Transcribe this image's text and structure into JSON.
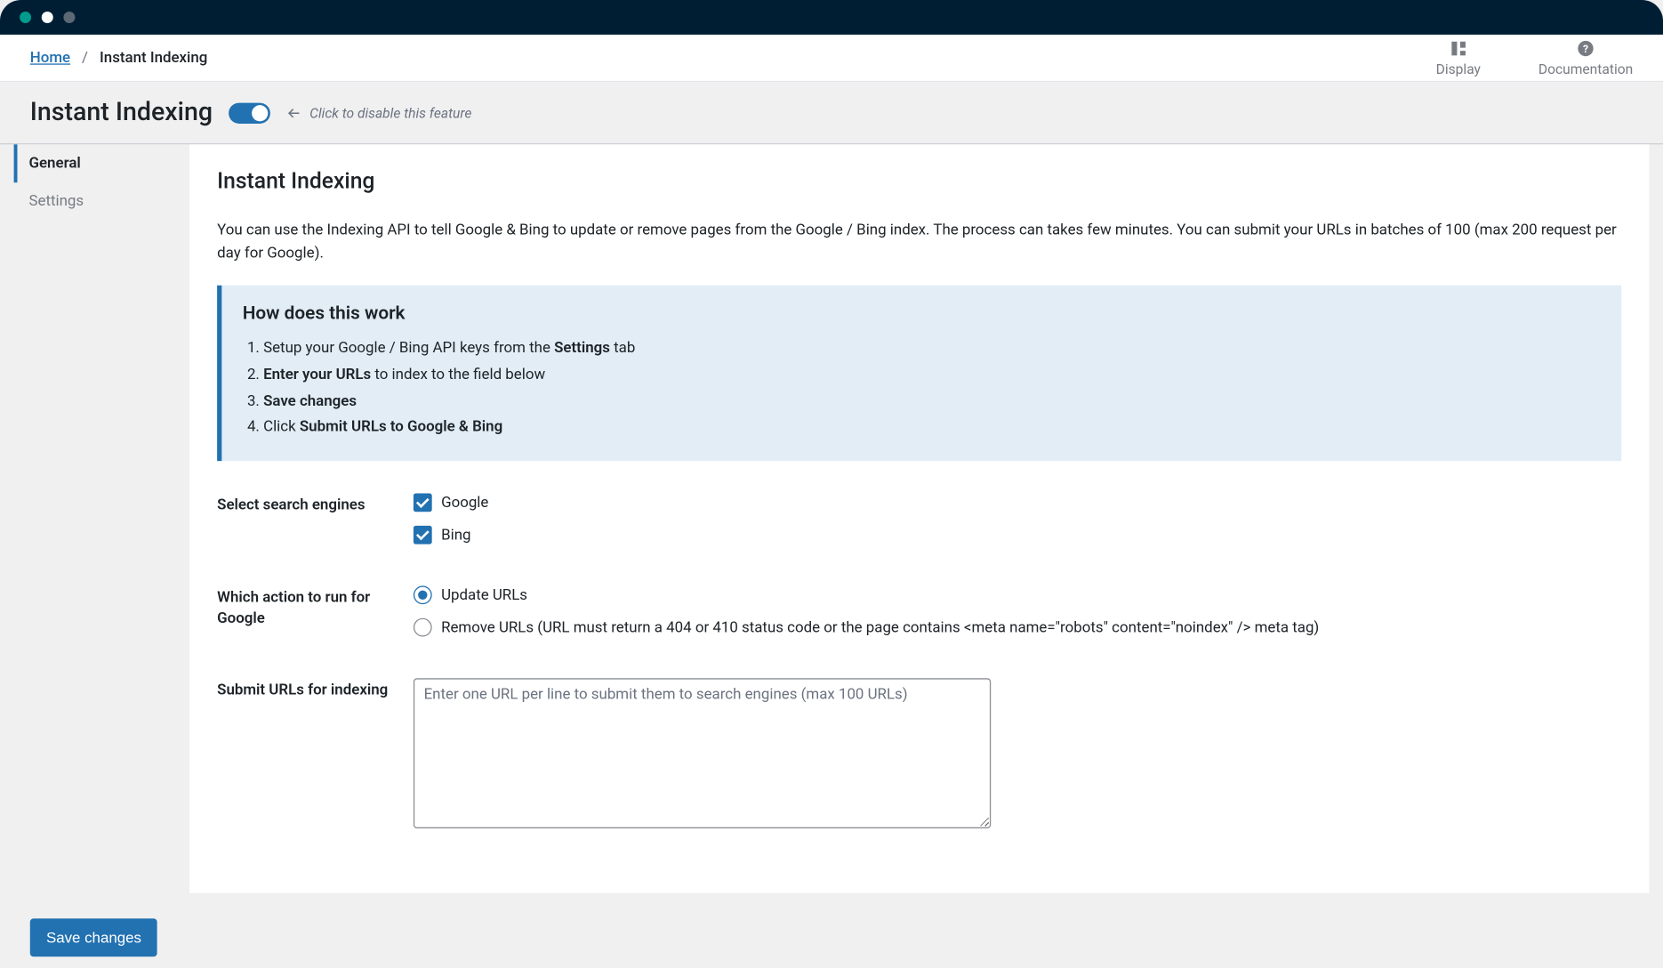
{
  "breadcrumb": {
    "home": "Home",
    "sep": "/",
    "current": "Instant Indexing"
  },
  "toplinks": {
    "display": "Display",
    "documentation": "Documentation"
  },
  "header": {
    "title": "Instant Indexing",
    "toggle_hint": "Click to disable this feature"
  },
  "tabs": [
    {
      "label": "General",
      "active": true
    },
    {
      "label": "Settings",
      "active": false
    }
  ],
  "panel": {
    "heading": "Instant Indexing",
    "description": "You can use the Indexing API to tell Google & Bing to update or remove pages from the Google / Bing index. The process can takes few minutes. You can submit your URLs in batches of 100 (max 200 request per day for Google).",
    "info": {
      "heading": "How does this work",
      "step1_pre": "Setup your Google / Bing API keys from the ",
      "step1_bold": "Settings",
      "step1_post": " tab",
      "step2_bold": "Enter your URLs",
      "step2_post": " to index to the field below",
      "step3_bold": "Save changes",
      "step4_pre": "Click ",
      "step4_bold": "Submit URLs to Google & Bing"
    },
    "engines": {
      "label": "Select search engines",
      "items": [
        {
          "name": "Google",
          "checked": true
        },
        {
          "name": "Bing",
          "checked": true
        }
      ]
    },
    "action": {
      "label": "Which action to run for Google",
      "items": [
        {
          "name": "Update URLs",
          "selected": true
        },
        {
          "name": "Remove URLs (URL must return a 404 or 410 status code or the page contains <meta name=\"robots\" content=\"noindex\" /> meta tag)",
          "selected": false
        }
      ]
    },
    "submit": {
      "label": "Submit URLs for indexing",
      "placeholder": "Enter one URL per line to submit them to search engines (max 100 URLs)"
    }
  },
  "save_button": "Save changes"
}
